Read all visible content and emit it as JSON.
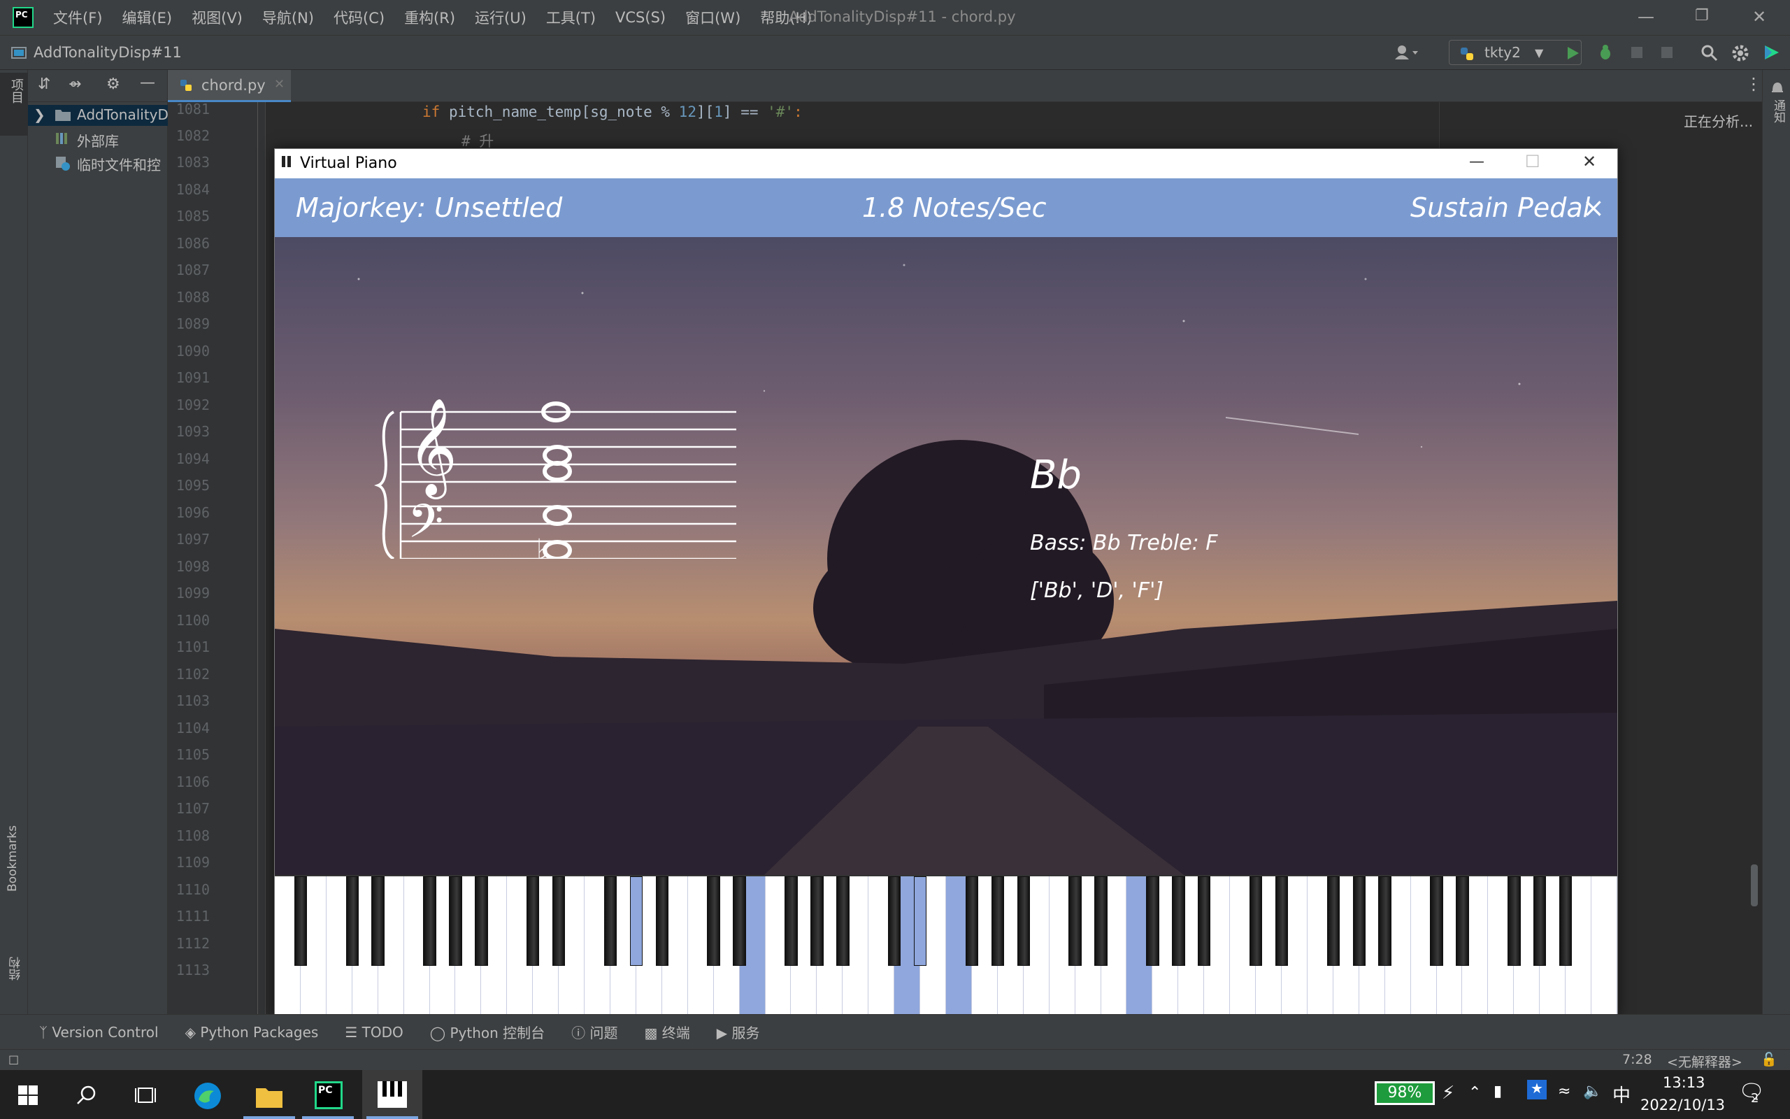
{
  "app": {
    "menu": [
      "文件(F)",
      "编辑(E)",
      "视图(V)",
      "导航(N)",
      "代码(C)",
      "重构(R)",
      "运行(U)",
      "工具(T)",
      "VCS(S)",
      "窗口(W)",
      "帮助(H)"
    ],
    "window_title": "AddTonalityDisp#11 - chord.py",
    "project_name": "AddTonalityDisp#11",
    "run_config": "tkty2"
  },
  "project_panel": {
    "items": [
      "AddTonalityD",
      "外部库",
      "临时文件和控"
    ],
    "side_labels": [
      "项目",
      "Bookmarks",
      "结构"
    ]
  },
  "editor": {
    "tab": "chord.py",
    "analysis_status": "正在分析...",
    "right_strip_label": "通知",
    "line_numbers": [
      "1081",
      "1082",
      "1083",
      "1084",
      "1085",
      "1086",
      "1087",
      "1088",
      "1089",
      "1090",
      "1091",
      "1092",
      "1093",
      "1094",
      "1095",
      "1096",
      "1097",
      "1098",
      "1099",
      "1100",
      "1101",
      "1102",
      "1103",
      "1104",
      "1105",
      "1106",
      "1107",
      "1108",
      "1109",
      "1110",
      "1111",
      "1112",
      "1113"
    ],
    "code_line_1_kw": "if",
    "code_line_1_a": " pitch_name_temp[sg_note % ",
    "code_line_1_num": "12",
    "code_line_1_b": "][",
    "code_line_1_num2": "1",
    "code_line_1_c": "] == ",
    "code_line_1_str": "'#'",
    "code_line_1_d": ":",
    "code_line_2": "# 升"
  },
  "piano_window": {
    "title": "Virtual Piano",
    "majorkey": "Majorkey: Unsettled",
    "rate": "1.8 Notes/Sec",
    "sustain": "Sustain Pedal",
    "sustain_close": "×",
    "chord_name": "Bb",
    "bass_treble": "Bass: Bb  Treble: F",
    "notes_list": "['Bb', 'D', 'F']",
    "highlight_color": "#8fa7dc",
    "banner_color": "#7b9bd0"
  },
  "bottom_tools": [
    "Version Control",
    "Python Packages",
    "TODO",
    "Python 控制台",
    "问题",
    "终端",
    "服务"
  ],
  "status": {
    "position": "7:28",
    "interpreter": "<无解释器>"
  },
  "taskbar": {
    "battery": "98%",
    "ime": "中",
    "time": "13:13",
    "date": "2022/10/13",
    "notifications": "2"
  }
}
